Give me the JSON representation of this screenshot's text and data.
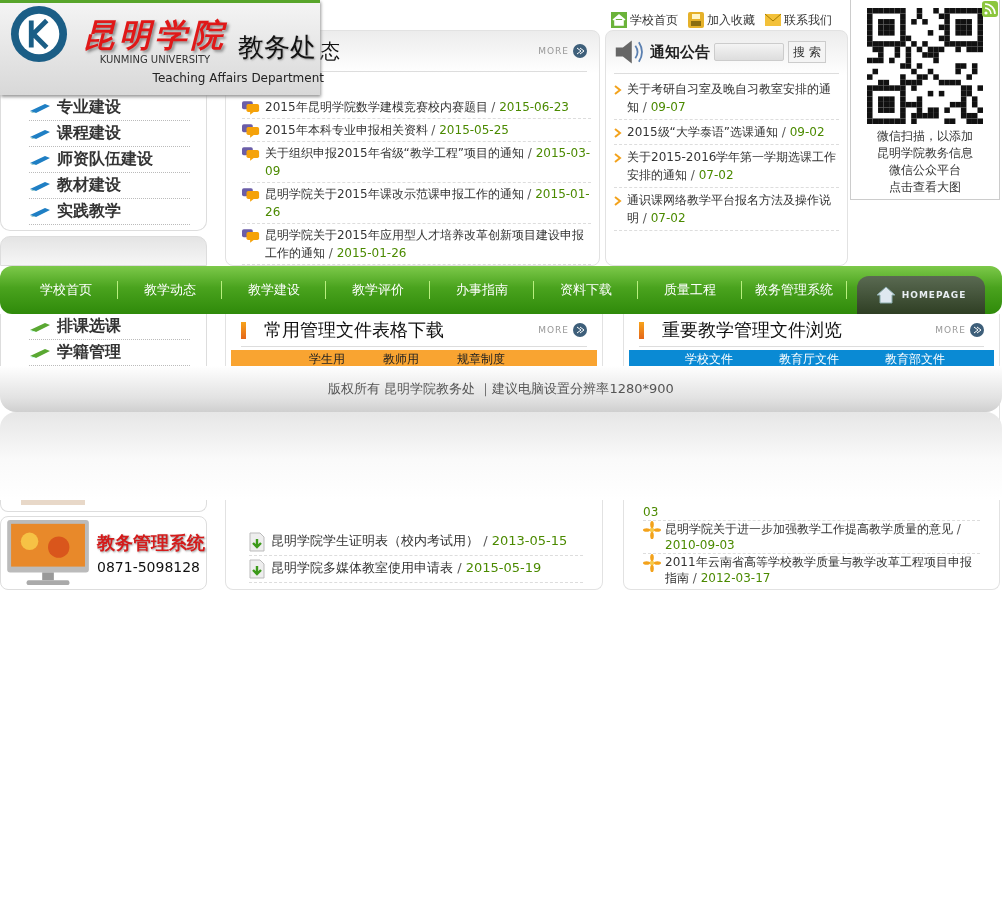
{
  "header": {
    "logo_text": "昆明学院",
    "logo_subtitle": "KUNMING UNIVERSITY",
    "department": "教务处",
    "department_en": "Teaching Affairs Department"
  },
  "top_links": [
    "学校首页",
    "加入收藏",
    "联系我们"
  ],
  "qr_popup": {
    "lines": [
      "微信扫描，以添加",
      "昆明学院教务信息",
      "微信公众平台",
      "点击查看大图"
    ]
  },
  "side_menu": {
    "items": [
      "专业建设",
      "课程建设",
      "师资队伍建设",
      "教材建设",
      "实践教学"
    ]
  },
  "side_menu_2": {
    "items": [
      "排课选课",
      "学籍管理"
    ]
  },
  "system_banner": {
    "title": "教务管理系统",
    "phone": "0871-5098128"
  },
  "news": {
    "title": "态",
    "more": "MORE",
    "separator": "/",
    "items": [
      {
        "title": "2015年昆明学院数学建模竞赛校内赛题目",
        "date": "2015-06-23"
      },
      {
        "title": "2015年本科专业申报相关资料",
        "date": "2015-05-25"
      },
      {
        "title": "关于组织申报2015年省级“教学工程”项目的通知",
        "date": "2015-03-09"
      },
      {
        "title": "昆明学院关于2015年课改示范课申报工作的通知",
        "date": "2015-01-26"
      },
      {
        "title": "昆明学院关于2015年应用型人才培养改革创新项目建设申报工作的通知",
        "date": "2015-01-26"
      }
    ]
  },
  "notices": {
    "title": "通知公告",
    "search_button": "搜 索",
    "separator": "/",
    "items": [
      {
        "title": "关于考研自习室及晚自习教室安排的通知",
        "date": "09-07"
      },
      {
        "title": "2015级“大学泰语”选课通知",
        "date": "09-02"
      },
      {
        "title": "关于2015-2016学年第一学期选课工作安排的通知",
        "date": "07-02"
      },
      {
        "title": "通识课网络教学平台报名方法及操作说明",
        "date": "07-02"
      }
    ]
  },
  "nav": {
    "items": [
      "学校首页",
      "教学动态",
      "教学建设",
      "教学评价",
      "办事指南",
      "资料下载",
      "质量工程",
      "教务管理系统"
    ],
    "homepage": "HOMEPAGE"
  },
  "downloads": {
    "title": "常用管理文件表格下载",
    "more": "MORE",
    "separator": "/",
    "tabs": [
      "学生用",
      "教师用",
      "规章制度"
    ],
    "items": [
      {
        "title": "昆明学院学生证明表（校内考试用）",
        "date": "2013-05-15"
      },
      {
        "title": "昆明学院多媒体教室使用申请表",
        "date": "2015-05-19"
      }
    ]
  },
  "documents": {
    "title": "重要教学管理文件浏览",
    "more": "MORE",
    "separator": "/",
    "tabs": [
      "学校文件",
      "教育厅文件",
      "教育部文件"
    ],
    "fragment": "03",
    "items": [
      {
        "title": "昆明学院关于进一步加强教学工作提高教学质量的意见",
        "date": "2010-09-03"
      },
      {
        "title": "2011年云南省高等学校教学质量与教学改革工程项目申报指南",
        "date": "2012-03-17"
      }
    ]
  },
  "footer": {
    "text": "版权所有 昆明学院教务处 ｜建议电脑设置分辨率1280*900"
  }
}
